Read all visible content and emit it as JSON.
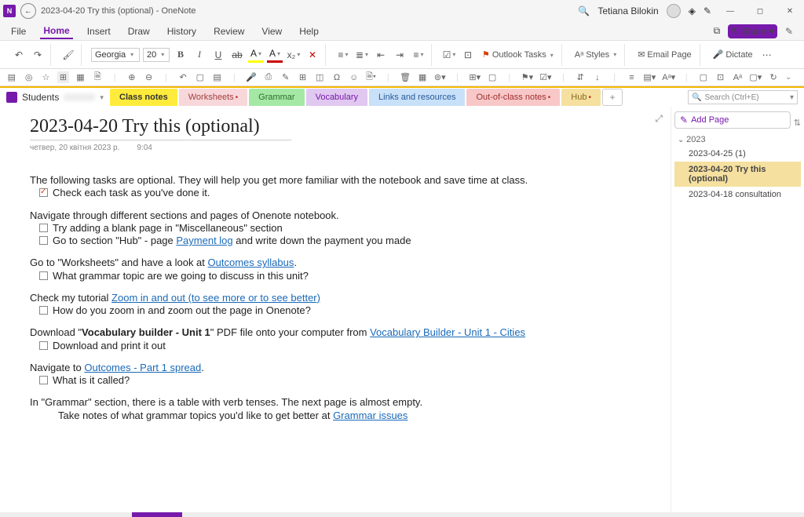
{
  "title": {
    "app": "N",
    "doc": "2023-04-20 Try this (optional)  -  OneNote",
    "user": "Tetiana Bilokin"
  },
  "menu": {
    "file": "File",
    "home": "Home",
    "insert": "Insert",
    "draw": "Draw",
    "history": "History",
    "review": "Review",
    "view": "View",
    "help": "Help",
    "share": "⇱ Share ▾"
  },
  "ribbon": {
    "font": "Georgia",
    "size": "20",
    "outlook": "Outlook Tasks",
    "styles": "Styles",
    "email": "Email Page",
    "dictate": "Dictate"
  },
  "notebook": {
    "name": "Students"
  },
  "tabs": {
    "t1": "Class notes",
    "t2": "Worksheets",
    "t3": "Grammar",
    "t4": "Vocabulary",
    "t5": "Links and resources",
    "t6": "Out-of-class notes",
    "t7": "Hub"
  },
  "search": {
    "placeholder": "Search (Ctrl+E)"
  },
  "page": {
    "title": "2023-04-20 Try this (optional)",
    "date": "четвер, 20 квітня 2023 р.",
    "time": "9:04"
  },
  "content": {
    "intro1": "The following tasks are optional. They will help you get more familiar with the notebook and save time at class.",
    "chk1": "Check each task as you've done it.",
    "nav1": "Navigate through different sections and pages of Onenote notebook.",
    "chk2": "Try adding a blank page in \"Miscellaneous\" section",
    "chk3a": "Go to section \"Hub\" - page ",
    "chk3link": "Payment log",
    "chk3b": " and write down the payment you made",
    "p2a": "Go to \"Worksheets\" and have a look at ",
    "p2link": "Outcomes syllabus",
    "p2b": ".",
    "chk4": "What grammar topic are we going to discuss in this unit?",
    "p3a": "Check my tutorial ",
    "p3link": "Zoom in and out (to see more or to see better)",
    "chk5": "How do you zoom in and zoom out the page in Onenote?",
    "p4a": "Download \"",
    "p4bold": "Vocabulary builder - Unit 1",
    "p4b": "\" PDF file onto your computer from ",
    "p4link": "Vocabulary Builder - Unit 1 - Cities",
    "chk6": "Download and print it out",
    "p5a": "Navigate to ",
    "p5link": "Outcomes - Part 1 spread",
    "p5b": ".",
    "chk7": "What is it called?",
    "p6a": "In \"Grammar\" section, there is a table with verb tenses. The next page is almost empty.",
    "p6b": "Take notes of what grammar topics you'd like to get better at ",
    "p6link": "Grammar issues"
  },
  "sidebar": {
    "add": "Add Page",
    "year": "2023",
    "p1": "2023-04-25 (1)",
    "p2": "2023-04-20 Try this (optional)",
    "p3": "2023-04-18 consultation"
  }
}
